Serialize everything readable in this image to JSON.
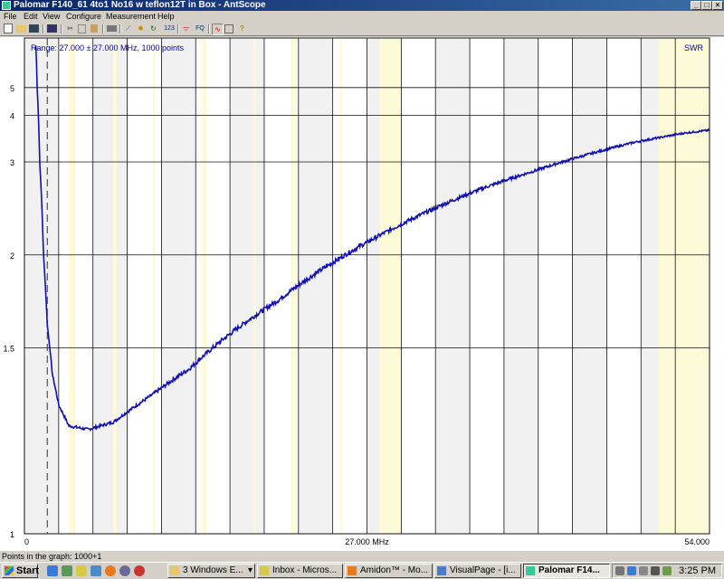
{
  "window": {
    "title": "Palomar F140_61 4to1 No16 w teflon12T in Box - AntScope",
    "minimize_glyph": "_",
    "maximize_glyph": "□",
    "close_glyph": "×"
  },
  "menu": [
    "File",
    "Edit",
    "View",
    "Configure",
    "Measurement",
    "Help"
  ],
  "toolbar": {
    "icons": [
      "new-icon",
      "open-icon",
      "save-icon",
      "export-icon",
      "cut-icon",
      "copy-icon",
      "paste-icon",
      "print-icon",
      "chart-icon",
      "sun-icon",
      "refresh-icon",
      "numbers-icon",
      "antenna-icon",
      "fq-icon",
      "graph-icon",
      "config-icon",
      "help-icon"
    ],
    "numbers_label": "123",
    "fq_label": "FQ"
  },
  "chart_data": {
    "type": "line",
    "range_label": "Range: 27.000 ± 27.000 MHz, 1000 points",
    "series_label": "SWR",
    "x_ticks": [
      "0",
      "27.000 MHz",
      "54.000"
    ],
    "y_ticks": [
      "1",
      "1.5",
      "2",
      "3",
      "4",
      "5"
    ],
    "xlim": [
      0,
      54
    ],
    "y_scale": "reciprocal",
    "ylim": [
      1,
      9
    ],
    "grid": true,
    "highlighted_bands_mhz": [
      [
        3.5,
        4.0
      ],
      [
        7.0,
        7.3
      ],
      [
        10.1,
        10.15
      ],
      [
        14.0,
        14.35
      ],
      [
        18.068,
        18.168
      ],
      [
        21.0,
        21.45
      ],
      [
        24.89,
        24.99
      ],
      [
        28.0,
        29.7
      ],
      [
        50.0,
        54.0
      ]
    ],
    "marker_x": 1.8,
    "series": [
      {
        "x": [
          0.9,
          1.0,
          1.2,
          1.5,
          1.8,
          2.2,
          2.7,
          3.5,
          5.0,
          7.0,
          10.0,
          13.0,
          16.0,
          20.0,
          24.0,
          28.0,
          32.0,
          36.0,
          40.0,
          44.0,
          48.0,
          52.0,
          54.0
        ],
        "values": [
          8.0,
          5.0,
          3.0,
          2.0,
          1.6,
          1.4,
          1.3,
          1.24,
          1.23,
          1.25,
          1.33,
          1.42,
          1.55,
          1.72,
          1.93,
          2.15,
          2.38,
          2.62,
          2.85,
          3.1,
          3.35,
          3.55,
          3.62
        ]
      }
    ]
  },
  "status": {
    "points_text": "Points in the graph: 1000+1"
  },
  "taskbar": {
    "start_label": "Start",
    "tasks": [
      {
        "label": "3 Windows E...",
        "icon_color": "#e8c66a",
        "has_arrow": true
      },
      {
        "label": "Inbox - Micros...",
        "icon_color": "#d8c84a"
      },
      {
        "label": "Amidon™ - Mo...",
        "icon_color": "#e87a1a"
      },
      {
        "label": "VisualPage - [i...",
        "icon_color": "#4a7ac8"
      },
      {
        "label": "Palomar F14...",
        "icon_color": "#3c9"
      }
    ],
    "arrow_glyph": "▾",
    "clock": "3:25 PM"
  }
}
